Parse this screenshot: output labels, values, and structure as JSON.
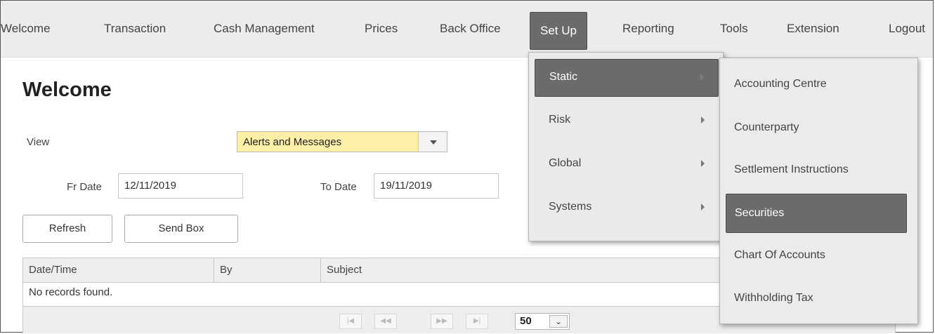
{
  "nav": {
    "items": [
      "Welcome",
      "Transaction",
      "Cash Management",
      "Prices",
      "Back Office",
      "Set Up",
      "Reporting",
      "Tools",
      "Extension",
      "Logout"
    ],
    "active": "Set Up"
  },
  "page": {
    "title": "Welcome",
    "view_label": "View",
    "view_value": "Alerts and Messages",
    "fr_date_label": "Fr Date",
    "fr_date_value": "12/11/2019",
    "to_date_label": "To Date",
    "to_date_value": "19/11/2019",
    "refresh_label": "Refresh",
    "sendbox_label": "Send Box"
  },
  "grid": {
    "columns": [
      "Date/Time",
      "By",
      "Subject"
    ],
    "empty_text": "No records found.",
    "pager": {
      "first": "|◀",
      "prev": "◀◀",
      "next": "▶▶",
      "last": "▶|",
      "page_size": "50",
      "page_size_icon": "⌄"
    }
  },
  "setup_menu": {
    "items": [
      "Static",
      "Risk",
      "Global",
      "Systems"
    ],
    "active": "Static"
  },
  "static_submenu": {
    "items": [
      "Accounting Centre",
      "Counterparty",
      "Settlement Instructions",
      "Securities",
      "Chart Of Accounts",
      "Withholding Tax"
    ],
    "active": "Securities"
  },
  "colors": {
    "nav_bg": "#ececec",
    "active_bg": "#6b6b6b",
    "select_bg": "#fdf0a6"
  }
}
